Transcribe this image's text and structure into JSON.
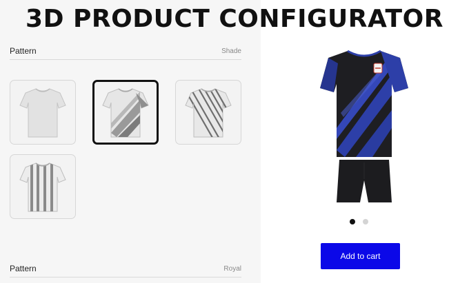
{
  "banner": {
    "title": "3D PRODUCT CONFIGURATOR"
  },
  "pattern_section": {
    "label": "Pattern",
    "value": "Shade",
    "swatches": [
      {
        "pattern": "plain",
        "selected": false
      },
      {
        "pattern": "diagonal-shade",
        "selected": true
      },
      {
        "pattern": "diagonal-stripes",
        "selected": false
      },
      {
        "pattern": "vertical-stripes",
        "selected": false
      }
    ]
  },
  "color_section": {
    "label": "Pattern",
    "value": "Royal"
  },
  "preview": {
    "image_count": 2,
    "active_image": 1,
    "colors": {
      "shirt": "#1e1e22",
      "accent": "#2d3fa8",
      "shorts": "#1c1c1f"
    }
  },
  "cart": {
    "add_label": "Add to cart",
    "button_color": "#0b08e8"
  }
}
